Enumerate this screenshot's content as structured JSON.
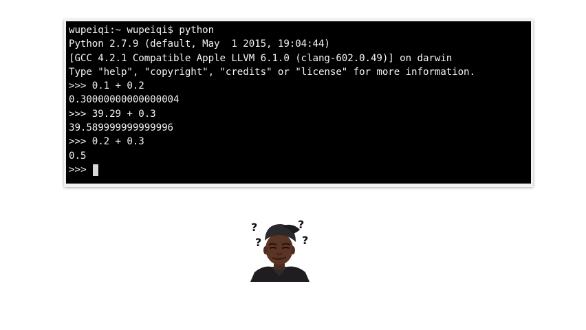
{
  "terminal": {
    "lines": [
      "wupeiqi:~ wupeiqi$ python",
      "Python 2.7.9 (default, May  1 2015, 19:04:44)",
      "[GCC 4.2.1 Compatible Apple LLVM 6.1.0 (clang-602.0.49)] on darwin",
      "Type \"help\", \"copyright\", \"credits\" or \"license\" for more information.",
      ">>> 0.1 + 0.2",
      "0.30000000000000004",
      ">>> 39.29 + 0.3",
      "39.589999999999996",
      ">>> 0.2 + 0.3",
      "0.5"
    ],
    "prompt": ">>> "
  },
  "meme": {
    "question_marks": [
      "?",
      "?",
      "?",
      "?"
    ],
    "icon": "confused-person-image"
  },
  "colors": {
    "terminal_bg": "#000000",
    "terminal_text": "#f4f4f4",
    "frame": "#f2f2f2",
    "page_bg": "#ffffff"
  }
}
